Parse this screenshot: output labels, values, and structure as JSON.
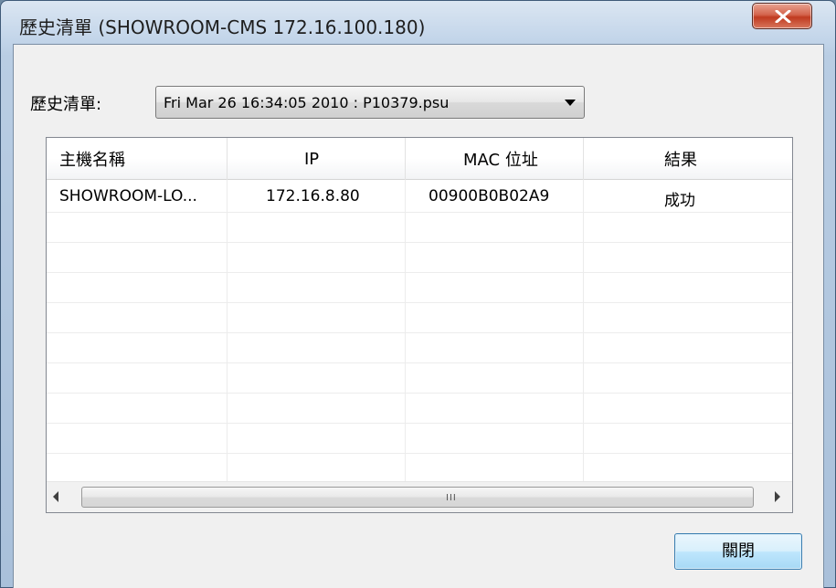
{
  "window": {
    "title": "歷史清單 (SHOWROOM-CMS  172.16.100.180)"
  },
  "history": {
    "label": "歷史清單:",
    "selected": "Fri Mar 26 16:34:05 2010 : P10379.psu"
  },
  "table": {
    "headers": [
      "主機名稱",
      "IP",
      "MAC 位址",
      "結果"
    ],
    "rows": [
      [
        "SHOWROOM-LO...",
        "172.16.8.80",
        "00900B0B02A9",
        "成功"
      ]
    ]
  },
  "scrollbar": {
    "grip": "III"
  },
  "buttons": {
    "close_label": "關閉"
  },
  "icons": {
    "close": "close-x-icon",
    "dropdown": "dropdown-arrow-icon",
    "scroll_left": "scroll-left-arrow-icon",
    "scroll_right": "scroll-right-arrow-icon"
  },
  "colors": {
    "close_button": "#c8452b",
    "default_button": "#bee6fd",
    "window_frame": "#b9cde3"
  }
}
